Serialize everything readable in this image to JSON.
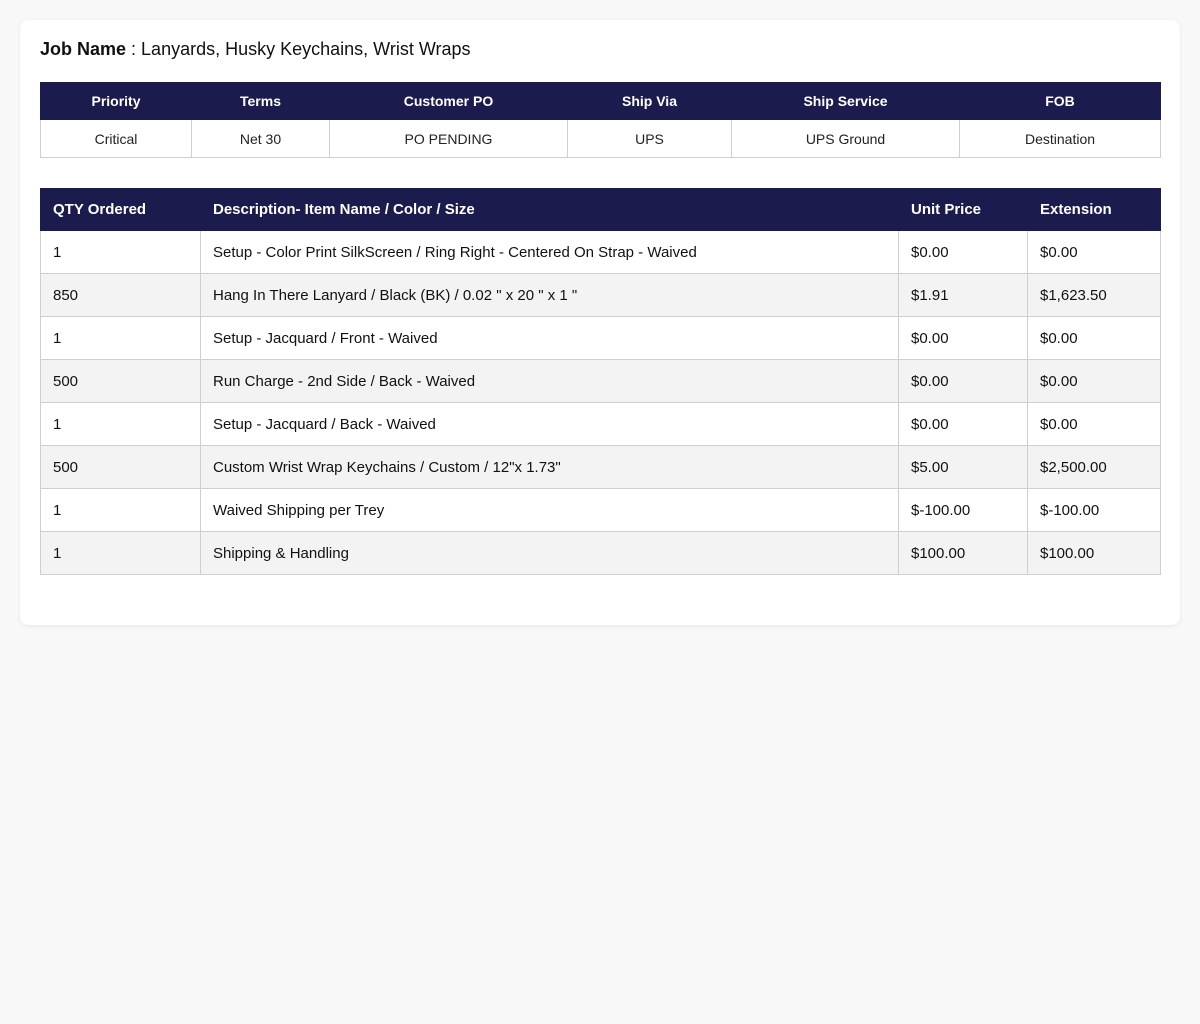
{
  "job": {
    "label": "Job Name",
    "separator": " : ",
    "value": "Lanyards, Husky Keychains, Wrist Wraps"
  },
  "info": {
    "headers": [
      "Priority",
      "Terms",
      "Customer PO",
      "Ship Via",
      "Ship Service",
      "FOB"
    ],
    "values": [
      "Critical",
      "Net 30",
      "PO PENDING",
      "UPS",
      "UPS Ground",
      "Destination"
    ]
  },
  "items": {
    "headers": [
      "QTY Ordered",
      "Description- Item Name / Color / Size",
      "Unit Price",
      "Extension"
    ],
    "rows": [
      {
        "qty": "1",
        "description": "Setup - Color Print SilkScreen / Ring Right - Centered On Strap - Waived",
        "unit_price": "$0.00",
        "extension": "$0.00"
      },
      {
        "qty": "850",
        "description": "Hang In There Lanyard / Black (BK) / 0.02 \" x 20 \" x 1 \"",
        "unit_price": "$1.91",
        "extension": "$1,623.50"
      },
      {
        "qty": "1",
        "description": "Setup - Jacquard / Front - Waived",
        "unit_price": "$0.00",
        "extension": "$0.00"
      },
      {
        "qty": "500",
        "description": "Run Charge - 2nd Side / Back - Waived",
        "unit_price": "$0.00",
        "extension": "$0.00"
      },
      {
        "qty": "1",
        "description": "Setup - Jacquard / Back - Waived",
        "unit_price": "$0.00",
        "extension": "$0.00"
      },
      {
        "qty": "500",
        "description": "Custom Wrist Wrap Keychains / Custom / 12\"x 1.73\"",
        "unit_price": "$5.00",
        "extension": "$2,500.00"
      },
      {
        "qty": "1",
        "description": "Waived Shipping per Trey",
        "unit_price": "$-100.00",
        "extension": "$-100.00"
      },
      {
        "qty": "1",
        "description": "Shipping & Handling",
        "unit_price": "$100.00",
        "extension": "$100.00"
      }
    ]
  },
  "colors": {
    "header_bg": "#1c1b4d",
    "page_bg": "#f8f8f8",
    "stripe_bg": "#f3f3f3"
  }
}
